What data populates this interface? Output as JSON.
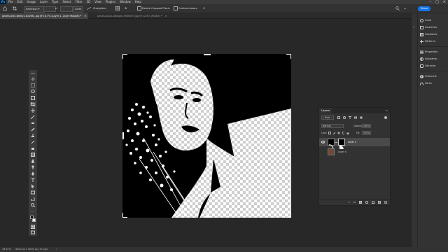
{
  "menubar": {
    "logo": "Ps",
    "items": [
      "File",
      "Edit",
      "Image",
      "Layer",
      "Type",
      "Select",
      "Filter",
      "3D",
      "View",
      "Plugins",
      "Window",
      "Help"
    ]
  },
  "options": {
    "selection_label": "Selection",
    "clear_label": "Clear",
    "straighten_label": "Straighten",
    "delete_cropped": "Delete Cropped Pixels",
    "content_aware": "Content-Aware",
    "share_label": "Share"
  },
  "tabs": [
    {
      "label": "pexels-lean-kelley-1812981.jpg @ 16.7% (Layer 1, Layer Mask/8) *"
    },
    {
      "label": "pexels-pixas-sebastio-9506097.jpg @ 12.5% (RGB/8) *"
    }
  ],
  "dock": {
    "items": [
      "Color",
      "Swatches",
      "Gradients",
      "Patterns",
      "Properties",
      "Adjustme...",
      "Libraries",
      "Channels",
      "Paths"
    ]
  },
  "layers": {
    "title": "Layers",
    "kind": "Kind",
    "blend_mode": "Normal",
    "opacity_label": "Opacity:",
    "opacity_value": "100%",
    "lock_label": "Lock:",
    "fill_label": "Fill:",
    "fill_value": "100%",
    "rows": [
      {
        "name": "Layer 1",
        "selected": true
      },
      {
        "name": "Layer 0",
        "selected": false
      }
    ]
  },
  "status": {
    "zoom": "16.67%",
    "doc_info": "4000 px x 4000 px (72 ppi)"
  },
  "colors": {
    "accent": "#1473e6",
    "app_bg": "#282828",
    "panel_bg": "#323232"
  }
}
